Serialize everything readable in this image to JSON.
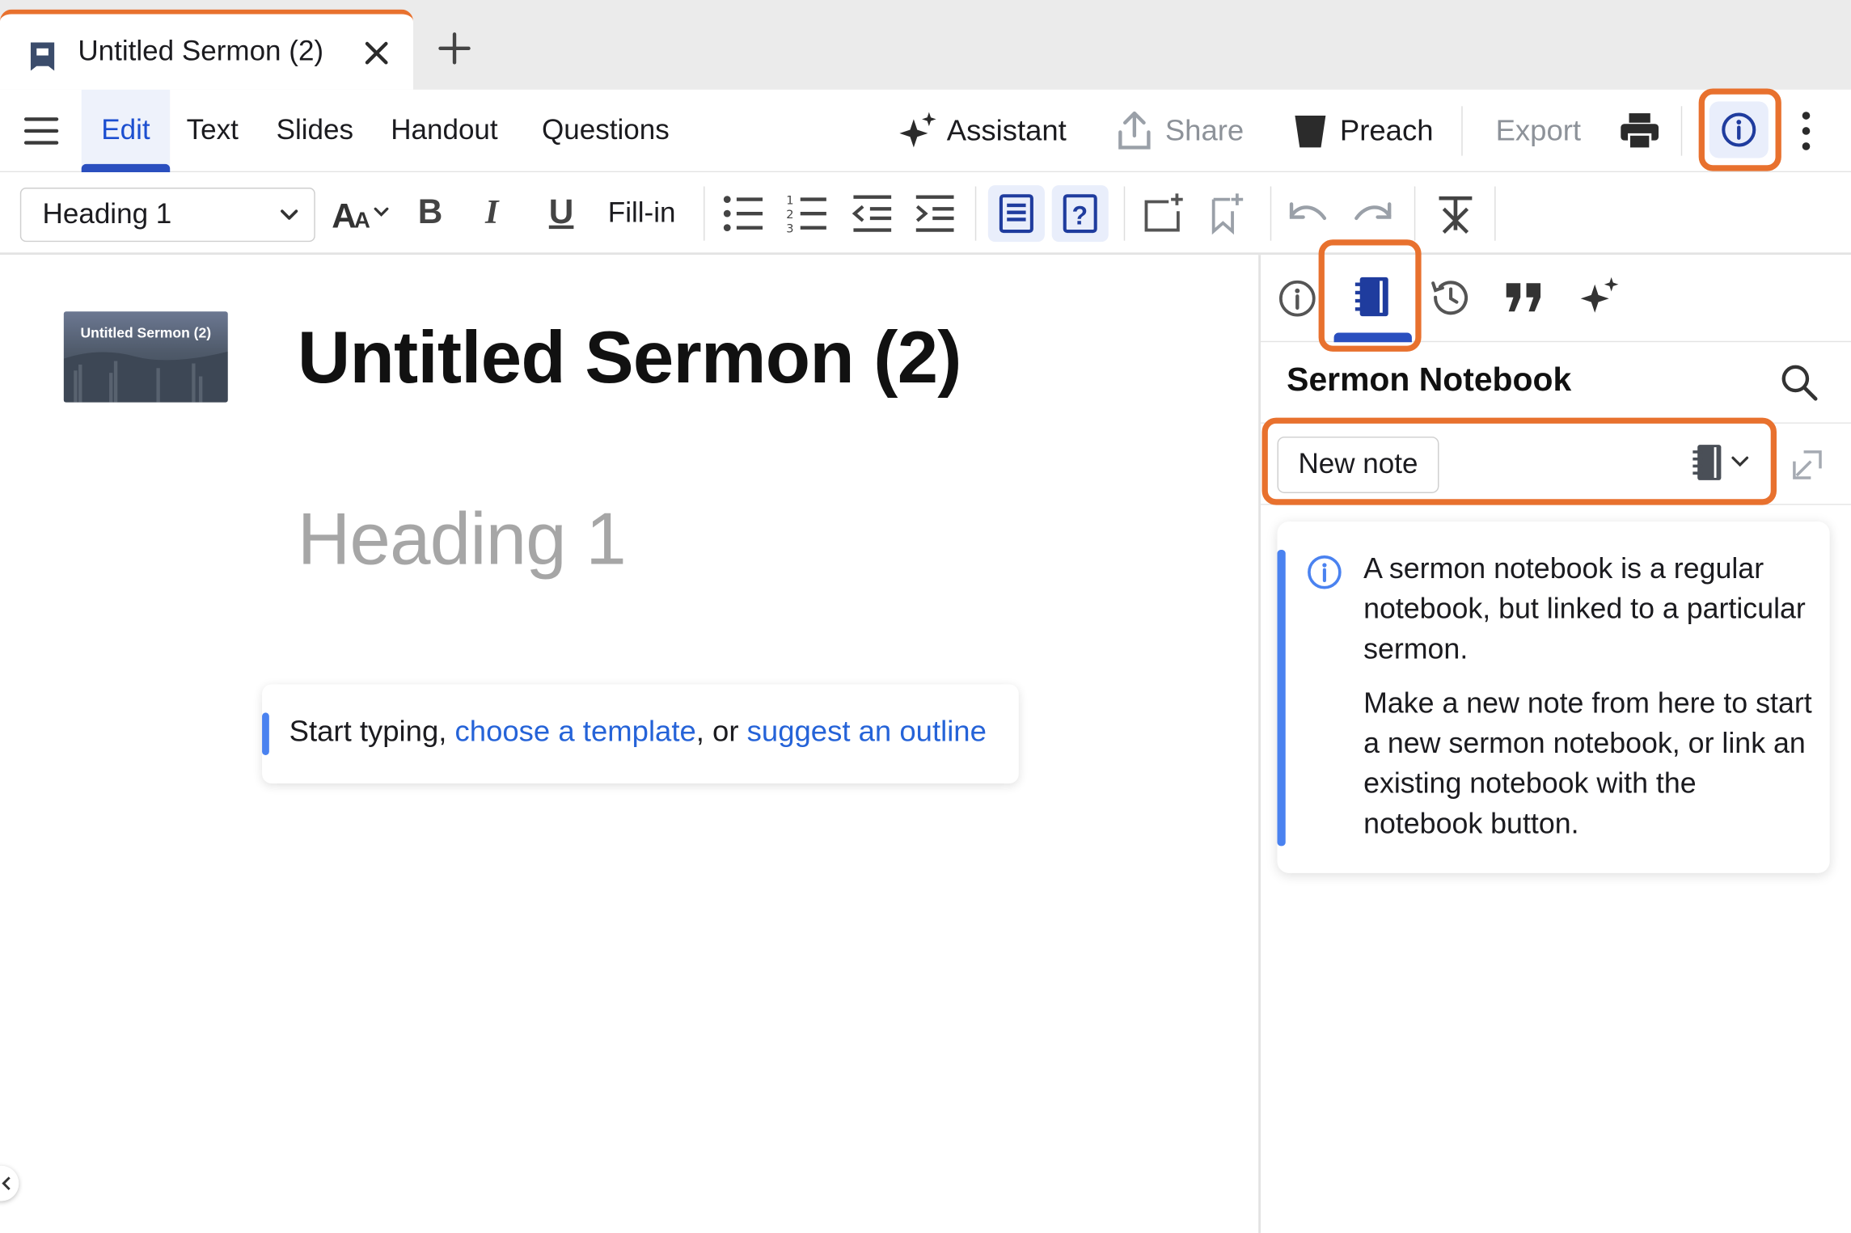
{
  "tab": {
    "title": "Untitled Sermon (2)",
    "close_glyph": "✕",
    "new_tab_glyph": "+",
    "icon": "sermon-doc-icon"
  },
  "menu": {
    "hamburger_icon": "hamburger-menu-icon",
    "items": [
      "Edit",
      "Text",
      "Slides",
      "Handout",
      "Questions"
    ],
    "active": "Edit"
  },
  "actions": {
    "assistant": "Assistant",
    "share": "Share",
    "preach": "Preach",
    "export": "Export"
  },
  "format_toolbar": {
    "style_value": "Heading 1",
    "fill_in": "Fill-in",
    "bold": "B",
    "italic": "I",
    "underline": "U"
  },
  "editor": {
    "thumbnail_text": "Untitled Sermon (2)",
    "title": "Untitled Sermon (2)",
    "heading_placeholder": "Heading 1",
    "start_prefix": "Start typing, ",
    "choose_template": "choose a template",
    "separator": ", or ",
    "suggest_outline": "suggest an outline"
  },
  "panel": {
    "tabs": [
      "info-tab",
      "notebook-tab",
      "history-tab",
      "quotes-tab",
      "assistant-tab"
    ],
    "active_tab": "notebook-tab",
    "title": "Sermon Notebook",
    "new_note": "New note",
    "info_p1": "A sermon notebook is a regular notebook, but linked to a particular sermon.",
    "info_p2": "Make a new note from here to start a new sermon notebook, or link an existing notebook with the notebook button."
  },
  "colors": {
    "accent_blue": "#2a4fbf",
    "link_blue": "#2563d8",
    "highlight_orange": "#e8712e",
    "info_bar_blue": "#4a82f0"
  }
}
